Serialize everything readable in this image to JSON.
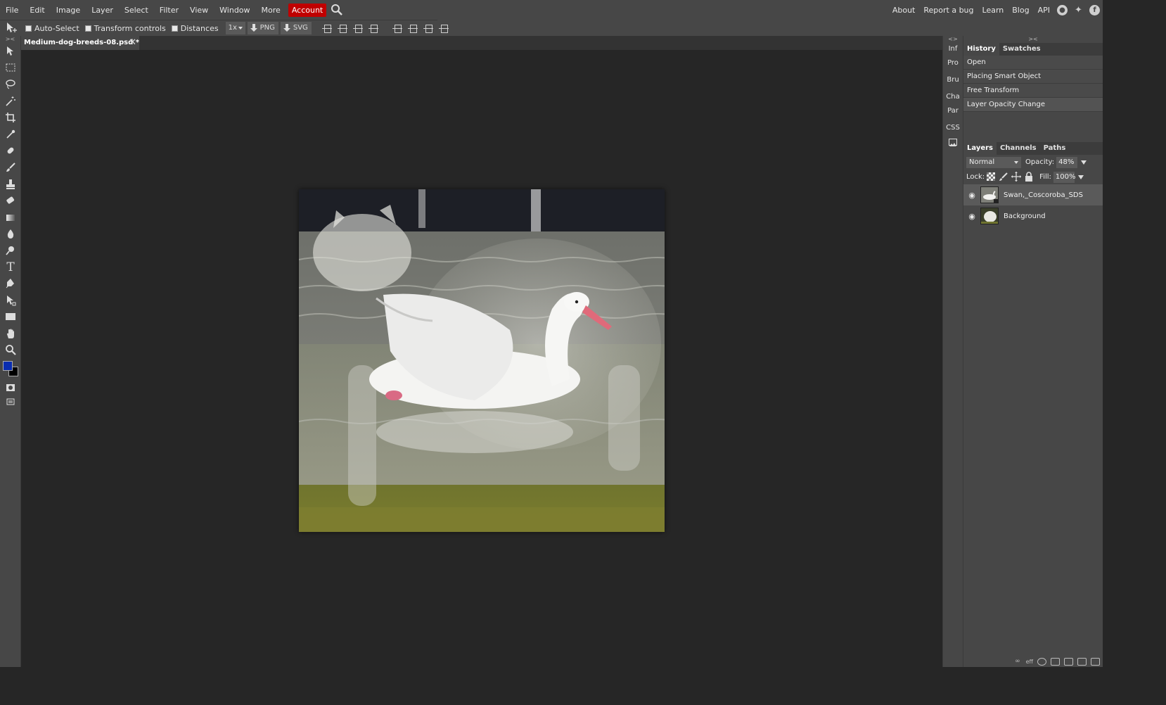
{
  "menubar": {
    "menus": [
      "File",
      "Edit",
      "Image",
      "Layer",
      "Select",
      "Filter",
      "View",
      "Window",
      "More"
    ],
    "account_label": "Account",
    "right_links": [
      "About",
      "Report a bug",
      "Learn",
      "Blog",
      "API"
    ]
  },
  "options": {
    "auto_select": "Auto-Select",
    "transform_controls": "Transform controls",
    "distances": "Distances",
    "zoom_value": "1x",
    "png_label": "PNG",
    "svg_label": "SVG"
  },
  "toolbar": {
    "fg_color": "#0a2db0",
    "bg_color": "#000000"
  },
  "document": {
    "tab_title": "Medium-dog-breeds-08.psd *",
    "close_glyph": "✕"
  },
  "mini_panel": {
    "items": [
      "Inf",
      "Pro",
      "Bru",
      "Cha",
      "Par",
      "CSS"
    ]
  },
  "history_panel": {
    "tabs": [
      "History",
      "Swatches"
    ],
    "items": [
      "Open",
      "Placing Smart Object",
      "Free Transform",
      "Layer Opacity Change"
    ]
  },
  "layers_panel": {
    "tabs": [
      "Layers",
      "Channels",
      "Paths"
    ],
    "blend_mode": "Normal",
    "opacity_label": "Opacity:",
    "opacity_value": "48%",
    "lock_label": "Lock:",
    "fill_label": "Fill:",
    "fill_value": "100%",
    "layers": [
      {
        "name": "Swan,_Coscoroba_SDS",
        "selected": true
      },
      {
        "name": "Background",
        "selected": false
      }
    ],
    "footer_eff": "eff"
  },
  "colors": {
    "accent": "#c00000",
    "panel": "#474747",
    "workspace": "#262626"
  }
}
